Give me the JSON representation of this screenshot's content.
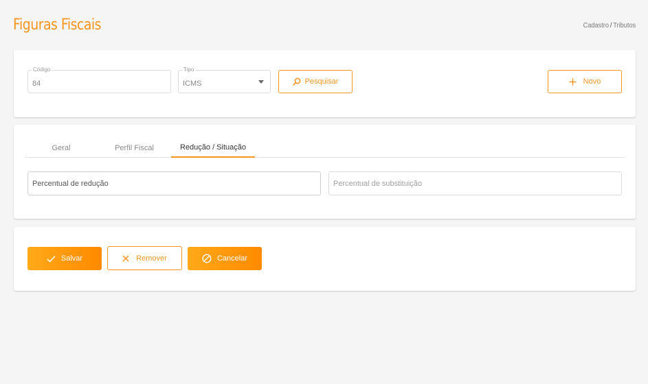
{
  "header": {
    "title": "Figuras Fiscais",
    "breadcrumb": [
      "Cadastro",
      "Tributos"
    ],
    "breadcrumb_separator": "/"
  },
  "search": {
    "codigo": {
      "label": "Código",
      "value": "84"
    },
    "tipo": {
      "label": "Tipo",
      "value": "ICMS"
    },
    "pesquisar_label": "Pesquisar",
    "novo_label": "Novo"
  },
  "tabs": [
    {
      "label": "Geral",
      "active": false
    },
    {
      "label": "Perfil Fiscal",
      "active": false
    },
    {
      "label": "Redução / Situação",
      "active": true
    }
  ],
  "form": {
    "percentual_reducao_placeholder": "Percentual de redução",
    "percentual_substituicao_placeholder": "Percentual de substituição"
  },
  "actions": {
    "salvar_label": "Salvar",
    "remover_label": "Remover",
    "cancelar_label": "Cancelar"
  },
  "colors": {
    "accent": "#f5951f",
    "button_gradient_start": "#ffa918",
    "button_gradient_end": "#ff8a00",
    "background": "#f5f5f5"
  },
  "icons": {
    "pesquisar": "search-icon",
    "novo": "plus-icon",
    "salvar": "check-icon",
    "remover": "close-icon",
    "cancelar": "cancel-icon",
    "tipo_select": "caret-down-icon"
  }
}
